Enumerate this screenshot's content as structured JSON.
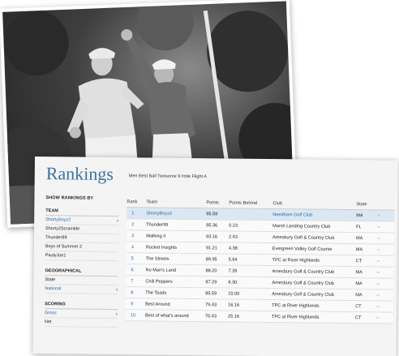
{
  "photo": {
    "description_icon": "golfers-celebrating-photo"
  },
  "rankings": {
    "title": "Rankings",
    "subtitle": "Men Best Ball Twosome 9 Hole Flight A",
    "sidebar": {
      "heading": "SHOW RANKINGS BY",
      "groups": [
        {
          "label": "TEAM",
          "items": [
            {
              "label": "ShortyBoyz2",
              "active": true,
              "chevron": "›"
            },
            {
              "label": "Shorty2Scramble"
            },
            {
              "label": "Thunder99"
            },
            {
              "label": "Boys of Summer 2"
            },
            {
              "label": "PaulyJoe1"
            }
          ]
        },
        {
          "label": "GEOGRAPHICAL",
          "items": [
            {
              "label": "State"
            },
            {
              "label": "National",
              "active": true,
              "chevron": "›"
            }
          ]
        },
        {
          "label": "SCORING",
          "items": [
            {
              "label": "Gross",
              "active": true,
              "chevron": "›"
            },
            {
              "label": "Net"
            }
          ]
        }
      ]
    },
    "columns": [
      "Rank",
      "Team",
      "Points",
      "Points Behind",
      "Club",
      "State"
    ],
    "rows": [
      {
        "rank": "1",
        "team": "ShortyBoyz2",
        "points": "95.59",
        "behind": "",
        "club": "Needham Golf Club",
        "state": "MA",
        "more": "--"
      },
      {
        "rank": "2",
        "team": "Thunder99",
        "points": "95.36",
        "behind": "0.23",
        "club": "Marsh Landing Country Club",
        "state": "FL",
        "more": "--"
      },
      {
        "rank": "3",
        "team": "Walking it",
        "points": "93.16",
        "behind": "2.43",
        "club": "Amesbury Golf & Country Club",
        "state": "MA",
        "more": "--"
      },
      {
        "rank": "4",
        "team": "Rocket Insights",
        "points": "91.21",
        "behind": "4.38",
        "club": "Evergreen Valley Golf Course",
        "state": "MA",
        "more": "--"
      },
      {
        "rank": "5",
        "team": "The Streets",
        "points": "89.95",
        "behind": "5.64",
        "club": "TPC at River Highlands",
        "state": "CT",
        "more": "--"
      },
      {
        "rank": "6",
        "team": "No Man's Land",
        "points": "88.20",
        "behind": "7.39",
        "club": "Amesbury Golf & Country Club",
        "state": "MA",
        "more": "--"
      },
      {
        "rank": "7",
        "team": "Chili Peppers",
        "points": "87.29",
        "behind": "8.30",
        "club": "Amesbury Golf & Country Club",
        "state": "MA",
        "more": "--"
      },
      {
        "rank": "8",
        "team": "The Toads",
        "points": "85.59",
        "behind": "10.00",
        "club": "Amesbury Golf & Country Club",
        "state": "MA",
        "more": "--"
      },
      {
        "rank": "9",
        "team": "Best Around",
        "points": "79.43",
        "behind": "16.16",
        "club": "TPC at River Highlands",
        "state": "CT",
        "more": "--"
      },
      {
        "rank": "10",
        "team": "Best of what's around",
        "points": "70.43",
        "behind": "25.16",
        "club": "TPC at River Highlands",
        "state": "CT",
        "more": "--"
      }
    ],
    "accent_color": "#2c68a6",
    "highlight_color": "#dbe8f4"
  }
}
